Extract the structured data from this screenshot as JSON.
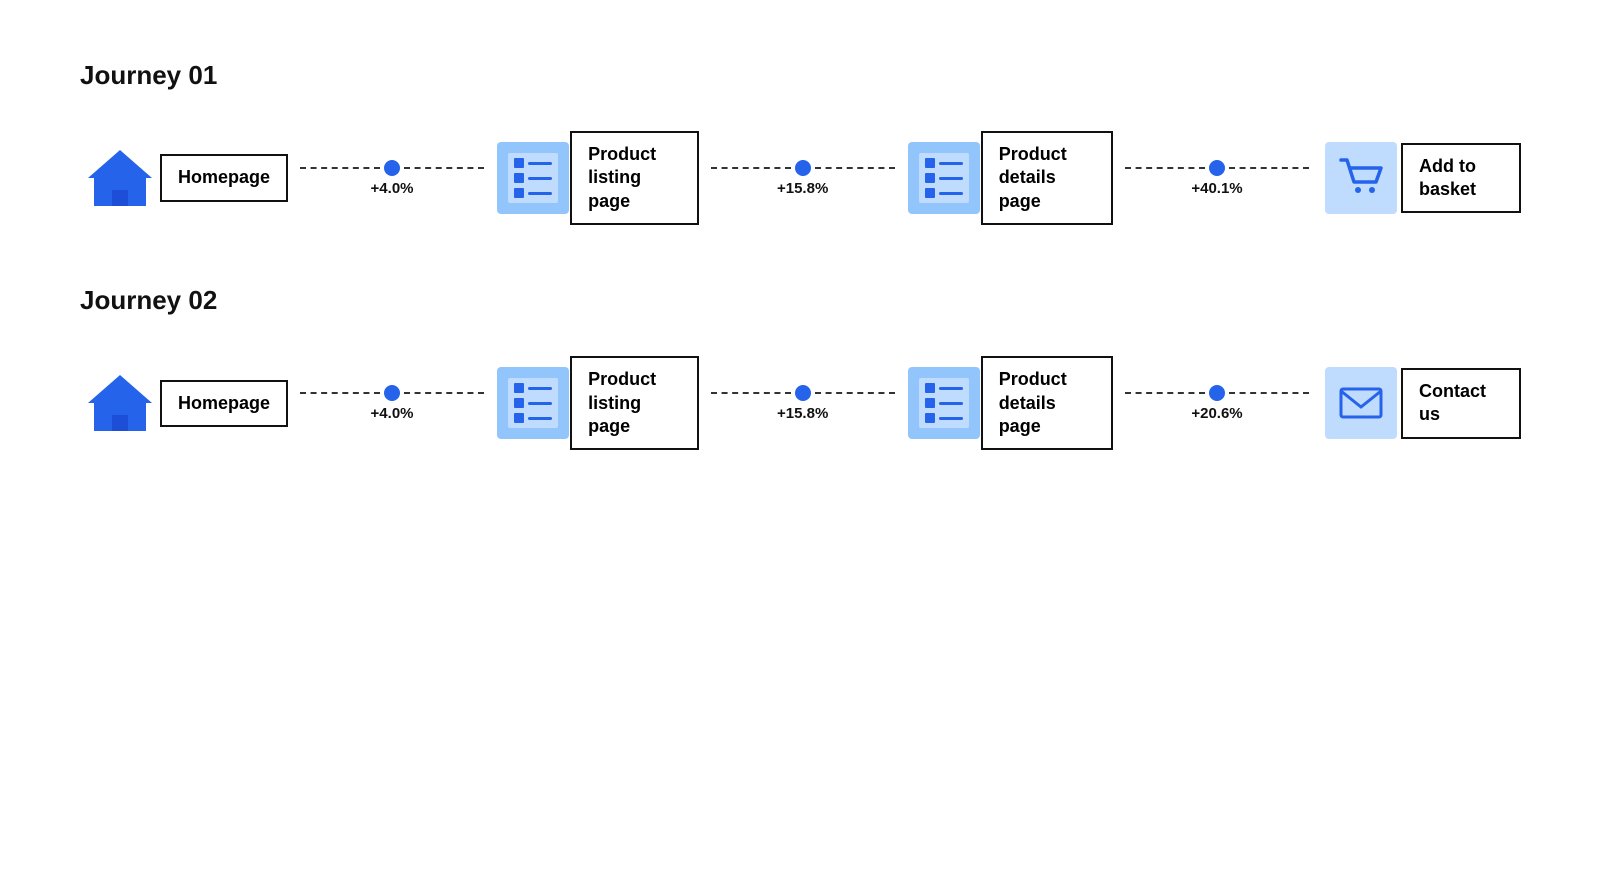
{
  "journey1": {
    "title": "Journey 01",
    "nodes": [
      {
        "id": "homepage",
        "label": "Homepage",
        "icon": "home"
      },
      {
        "id": "product-listing",
        "label": "Product\nlisting page",
        "icon": "list"
      },
      {
        "id": "product-details",
        "label": "Product\ndetails page",
        "icon": "list"
      },
      {
        "id": "add-to-basket",
        "label": "Add to\nbasket",
        "icon": "cart"
      }
    ],
    "connectors": [
      {
        "pct": "+4.0%"
      },
      {
        "pct": "+15.8%"
      },
      {
        "pct": "+40.1%"
      }
    ]
  },
  "journey2": {
    "title": "Journey 02",
    "nodes": [
      {
        "id": "homepage",
        "label": "Homepage",
        "icon": "home"
      },
      {
        "id": "product-listing",
        "label": "Product\nlisting page",
        "icon": "list"
      },
      {
        "id": "product-details",
        "label": "Product\ndetails page",
        "icon": "list"
      },
      {
        "id": "contact-us",
        "label": "Contact\nus",
        "icon": "envelope"
      }
    ],
    "connectors": [
      {
        "pct": "+4.0%"
      },
      {
        "pct": "+15.8%"
      },
      {
        "pct": "+20.6%"
      }
    ]
  }
}
